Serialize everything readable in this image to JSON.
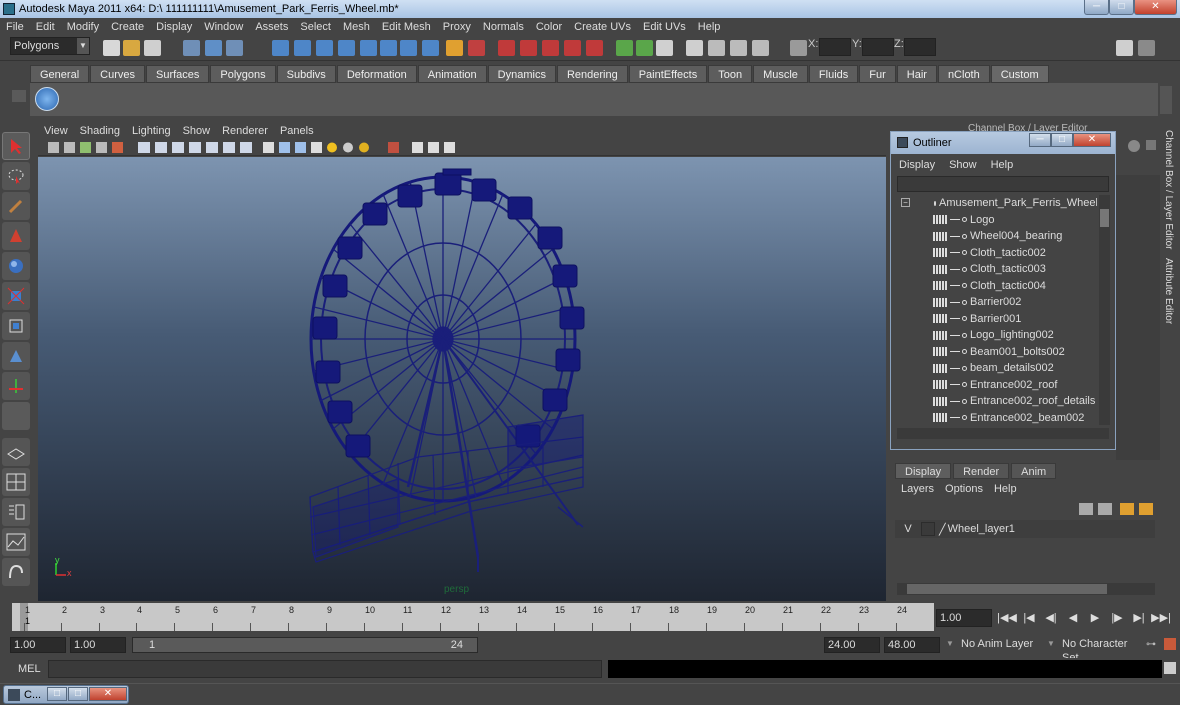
{
  "window": {
    "title": "Autodesk Maya 2011 x64: D:\\ 111111111\\Amusement_Park_Ferris_Wheel.mb*",
    "minimize": "─",
    "maximize": "□",
    "close": "✕"
  },
  "menubar": [
    "File",
    "Edit",
    "Modify",
    "Create",
    "Display",
    "Window",
    "Assets",
    "Select",
    "Mesh",
    "Edit Mesh",
    "Proxy",
    "Normals",
    "Color",
    "Create UVs",
    "Edit UVs",
    "Help"
  ],
  "status_line": {
    "mode": "Polygons",
    "x_label": "X:",
    "y_label": "Y:",
    "z_label": "Z:"
  },
  "shelf_tabs": [
    "General",
    "Curves",
    "Surfaces",
    "Polygons",
    "Subdivs",
    "Deformation",
    "Animation",
    "Dynamics",
    "Rendering",
    "PaintEffects",
    "Toon",
    "Muscle",
    "Fluids",
    "Fur",
    "Hair",
    "nCloth",
    "Custom"
  ],
  "shelf_active": "Custom",
  "panel_menu": [
    "View",
    "Shading",
    "Lighting",
    "Show",
    "Renderer",
    "Panels"
  ],
  "viewport": {
    "camera": "persp",
    "axis_y": "y",
    "axis_x": "x"
  },
  "outliner": {
    "title": "Outliner",
    "menu": [
      "Display",
      "Show",
      "Help"
    ],
    "items": [
      "Amusement_Park_Ferris_Wheel",
      "Logo",
      "Wheel004_bearing",
      "Cloth_tactic002",
      "Cloth_tactic003",
      "Cloth_tactic004",
      "Barrier002",
      "Barrier001",
      "Logo_lighting002",
      "Beam001_bolts002",
      "beam_details002",
      "Entrance002_roof",
      "Entrance002_roof_details",
      "Entrance002_beam002"
    ]
  },
  "channel_box_title": "Channel Box / Layer Editor",
  "right_tabs": [
    "Channel Box / Layer Editor",
    "Attribute Editor"
  ],
  "layer_editor": {
    "tabs": [
      "Display",
      "Render",
      "Anim"
    ],
    "active_tab": "Display",
    "menu": [
      "Layers",
      "Options",
      "Help"
    ],
    "layers": [
      {
        "visible": "V",
        "name": "Wheel_layer1"
      }
    ]
  },
  "time_slider": {
    "ticks": [
      "1",
      "2",
      "3",
      "4",
      "5",
      "6",
      "7",
      "8",
      "9",
      "10",
      "11",
      "12",
      "13",
      "14",
      "15",
      "16",
      "17",
      "18",
      "19",
      "20",
      "21",
      "22",
      "23",
      "24"
    ],
    "current_frame": "1.00",
    "current_marker": "1"
  },
  "playback": [
    "|◀◀",
    "|◀",
    "◀|",
    "◀",
    "▶",
    "|▶",
    "▶|",
    "▶▶|"
  ],
  "range": {
    "start": "1.00",
    "inner_start": "1.00",
    "slider_start": "1",
    "slider_end": "24",
    "end": "24.00",
    "outer_end": "48.00",
    "anim_layer": "No Anim Layer",
    "character_set": "No Character Set"
  },
  "command_line": {
    "label": "MEL"
  },
  "minimized_window": {
    "label": "C..."
  }
}
